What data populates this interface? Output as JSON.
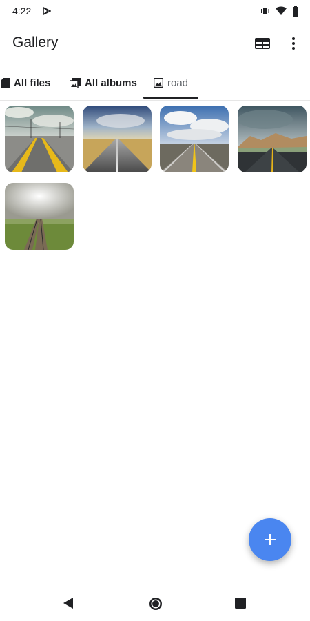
{
  "status_bar": {
    "time": "4:22",
    "icons": [
      "play-store-icon",
      "vibrate-icon",
      "wifi-icon",
      "battery-icon"
    ]
  },
  "app_bar": {
    "title": "Gallery",
    "actions": [
      "view-toggle-icon",
      "more-vert-icon"
    ]
  },
  "tabs": [
    {
      "label": "All files",
      "icon": "file-icon",
      "active": false
    },
    {
      "label": "All albums",
      "icon": "albums-icon",
      "active": false
    },
    {
      "label": "road",
      "icon": "image-icon",
      "active": true
    }
  ],
  "photos": [
    {
      "subject": "road with yellow lines and power lines"
    },
    {
      "subject": "straight road under blue sky"
    },
    {
      "subject": "highway with yellow center line and clouds"
    },
    {
      "subject": "road toward mountains under stormy sky"
    },
    {
      "subject": "railway tracks in green field with fog"
    }
  ],
  "fab": {
    "icon": "add-icon"
  },
  "nav_bar": {
    "icons": [
      "back-icon",
      "home-icon",
      "recents-icon"
    ]
  },
  "colors": {
    "accent": "#4a86f0",
    "text": "#202124",
    "secondary_text": "#5f6368"
  }
}
